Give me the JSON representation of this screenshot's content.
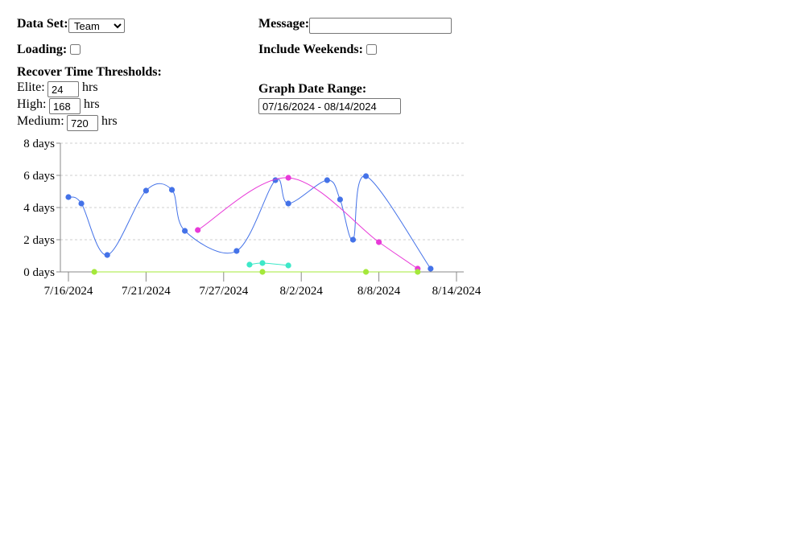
{
  "controls": {
    "data_set_label": "Data Set:",
    "data_set_value": "Team",
    "data_set_options": [
      "Team"
    ],
    "message_label": "Message:",
    "message_value": "",
    "loading_label": "Loading:",
    "loading_checked": false,
    "include_weekends_label": "Include Weekends:",
    "include_weekends_checked": false,
    "thresholds_title": "Recover Time Thresholds:",
    "elite_label": "Elite:",
    "elite_value": "24",
    "high_label": "High:",
    "high_value": "168",
    "medium_label": "Medium:",
    "medium_value": "720",
    "unit_hrs": "hrs",
    "date_range_label": "Graph Date Range:",
    "date_range_value": "07/16/2024 - 08/14/2024"
  },
  "chart_data": {
    "type": "line",
    "ylim": [
      0,
      8
    ],
    "y_ticks": [
      "0 days",
      "2 days",
      "4 days",
      "6 days",
      "8 days"
    ],
    "y_tick_values": [
      0,
      2,
      4,
      6,
      8
    ],
    "x_ticks": [
      "7/16/2024",
      "7/21/2024",
      "7/27/2024",
      "8/2/2024",
      "8/8/2024",
      "8/14/2024"
    ],
    "x_tick_days": [
      0,
      6,
      12,
      18,
      24,
      30
    ],
    "xlim_days": [
      0,
      30
    ],
    "x_origin": "7/16/2024",
    "grid": "horizontal dashed",
    "series": [
      {
        "color": "#4472e8",
        "points": [
          [
            0,
            4.65
          ],
          [
            1,
            4.25
          ],
          [
            3,
            1.05
          ],
          [
            6,
            5.05
          ],
          [
            8,
            5.1
          ],
          [
            9,
            2.55
          ],
          [
            13,
            1.3
          ],
          [
            16,
            5.7
          ],
          [
            17,
            4.25
          ],
          [
            20,
            5.7
          ],
          [
            21,
            4.5
          ],
          [
            22,
            2.0
          ],
          [
            23,
            5.95
          ],
          [
            28,
            0.2
          ]
        ]
      },
      {
        "color": "#e83ad8",
        "points": [
          [
            10,
            2.6
          ],
          [
            17,
            5.85
          ],
          [
            24,
            1.85
          ],
          [
            27,
            0.2
          ]
        ]
      },
      {
        "color": "#3de8c8",
        "points": [
          [
            14,
            0.45
          ],
          [
            15,
            0.55
          ],
          [
            17,
            0.4
          ]
        ]
      },
      {
        "color": "#a4e83a",
        "points": [
          [
            2,
            0.0
          ],
          [
            15,
            0.0
          ],
          [
            23,
            0.0
          ],
          [
            27,
            0.0
          ]
        ]
      }
    ]
  }
}
